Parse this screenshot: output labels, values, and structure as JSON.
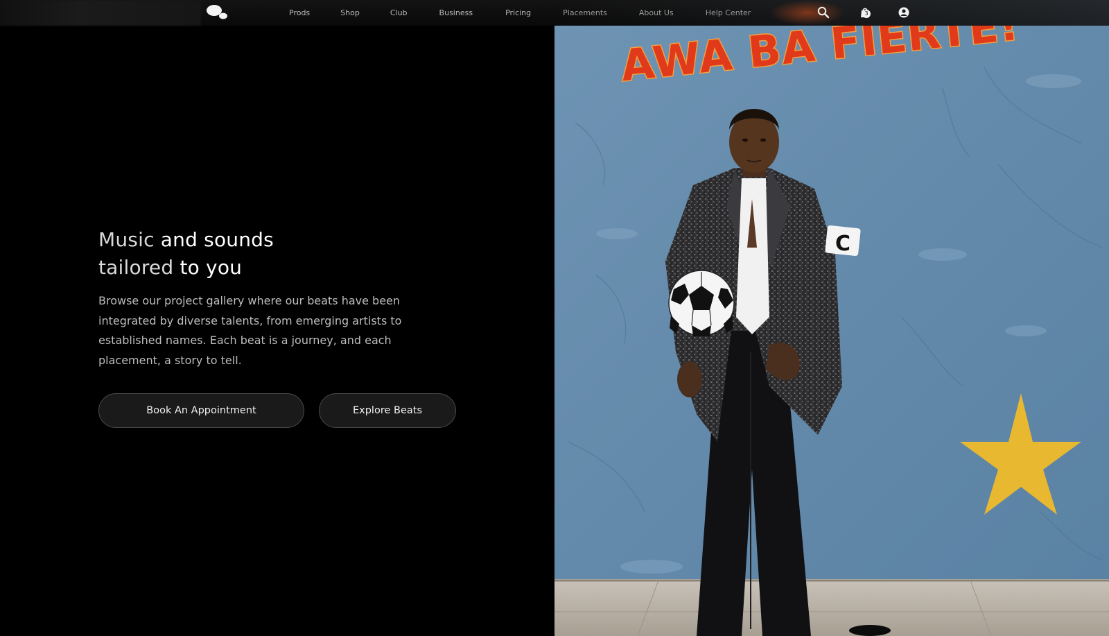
{
  "nav": {
    "links": [
      {
        "label": "Prods"
      },
      {
        "label": "Shop"
      },
      {
        "label": "Club"
      },
      {
        "label": "Business"
      },
      {
        "label": "Pricing"
      },
      {
        "label": "Placements"
      },
      {
        "label": "About Us"
      },
      {
        "label": "Help Center"
      }
    ],
    "icons": {
      "search": "search-icon",
      "cart": "cart-icon",
      "account": "user-icon"
    },
    "cart_count": "3"
  },
  "hero": {
    "title_line1_a": "Music ",
    "title_line1_b": "and sounds",
    "title_line2_a": "tailored ",
    "title_line2_b": "to you",
    "description": "Browse our project gallery where our beats have been integrated by diverse talents, from emerging artists to established names. Each beat is a journey, and each placement, a story to tell.",
    "buttons": {
      "book": "Book An Appointment",
      "explore": "Explore Beats"
    }
  },
  "image": {
    "graffiti_text": "AWA BA FIERTE!",
    "armband_letter": "C"
  },
  "colors": {
    "background": "#000000",
    "button_bg": "#1a1a1a",
    "wall_blue": "#6b8fae",
    "star_yellow": "#e8b830",
    "graffiti_red": "#e03a1a"
  }
}
